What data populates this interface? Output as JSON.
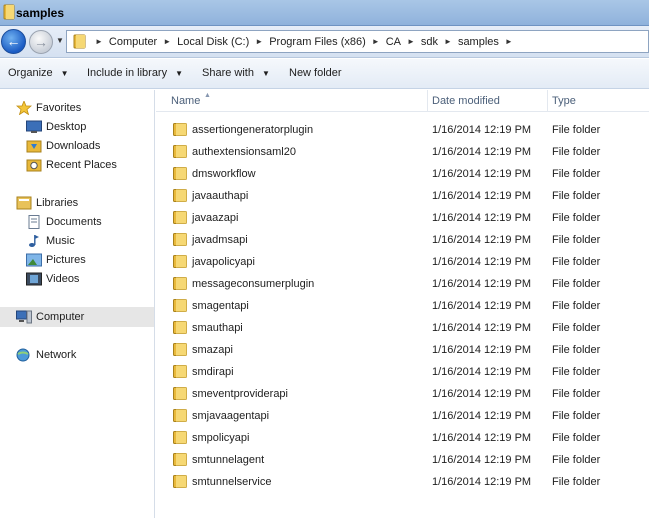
{
  "window": {
    "title": "samples"
  },
  "address": {
    "crumbs": [
      "Computer",
      "Local Disk (C:)",
      "Program Files (x86)",
      "CA",
      "sdk",
      "samples"
    ]
  },
  "toolbar": {
    "organize": "Organize",
    "include": "Include in library",
    "share": "Share with",
    "new_folder": "New folder"
  },
  "nav": {
    "favorites": "Favorites",
    "desktop": "Desktop",
    "downloads": "Downloads",
    "recent": "Recent Places",
    "libraries": "Libraries",
    "documents": "Documents",
    "music": "Music",
    "pictures": "Pictures",
    "videos": "Videos",
    "computer": "Computer",
    "network": "Network"
  },
  "columns": {
    "name": "Name",
    "date": "Date modified",
    "type": "Type"
  },
  "files": [
    {
      "name": "assertiongeneratorplugin",
      "date": "1/16/2014 12:19 PM",
      "type": "File folder"
    },
    {
      "name": "authextensionsaml20",
      "date": "1/16/2014 12:19 PM",
      "type": "File folder"
    },
    {
      "name": "dmsworkflow",
      "date": "1/16/2014 12:19 PM",
      "type": "File folder"
    },
    {
      "name": "javaauthapi",
      "date": "1/16/2014 12:19 PM",
      "type": "File folder"
    },
    {
      "name": "javaazapi",
      "date": "1/16/2014 12:19 PM",
      "type": "File folder"
    },
    {
      "name": "javadmsapi",
      "date": "1/16/2014 12:19 PM",
      "type": "File folder"
    },
    {
      "name": "javapolicyapi",
      "date": "1/16/2014 12:19 PM",
      "type": "File folder"
    },
    {
      "name": "messageconsumerplugin",
      "date": "1/16/2014 12:19 PM",
      "type": "File folder"
    },
    {
      "name": "smagentapi",
      "date": "1/16/2014 12:19 PM",
      "type": "File folder"
    },
    {
      "name": "smauthapi",
      "date": "1/16/2014 12:19 PM",
      "type": "File folder"
    },
    {
      "name": "smazapi",
      "date": "1/16/2014 12:19 PM",
      "type": "File folder"
    },
    {
      "name": "smdirapi",
      "date": "1/16/2014 12:19 PM",
      "type": "File folder"
    },
    {
      "name": "smeventproviderapi",
      "date": "1/16/2014 12:19 PM",
      "type": "File folder"
    },
    {
      "name": "smjavaagentapi",
      "date": "1/16/2014 12:19 PM",
      "type": "File folder"
    },
    {
      "name": "smpolicyapi",
      "date": "1/16/2014 12:19 PM",
      "type": "File folder"
    },
    {
      "name": "smtunnelagent",
      "date": "1/16/2014 12:19 PM",
      "type": "File folder"
    },
    {
      "name": "smtunnelservice",
      "date": "1/16/2014 12:19 PM",
      "type": "File folder"
    }
  ]
}
